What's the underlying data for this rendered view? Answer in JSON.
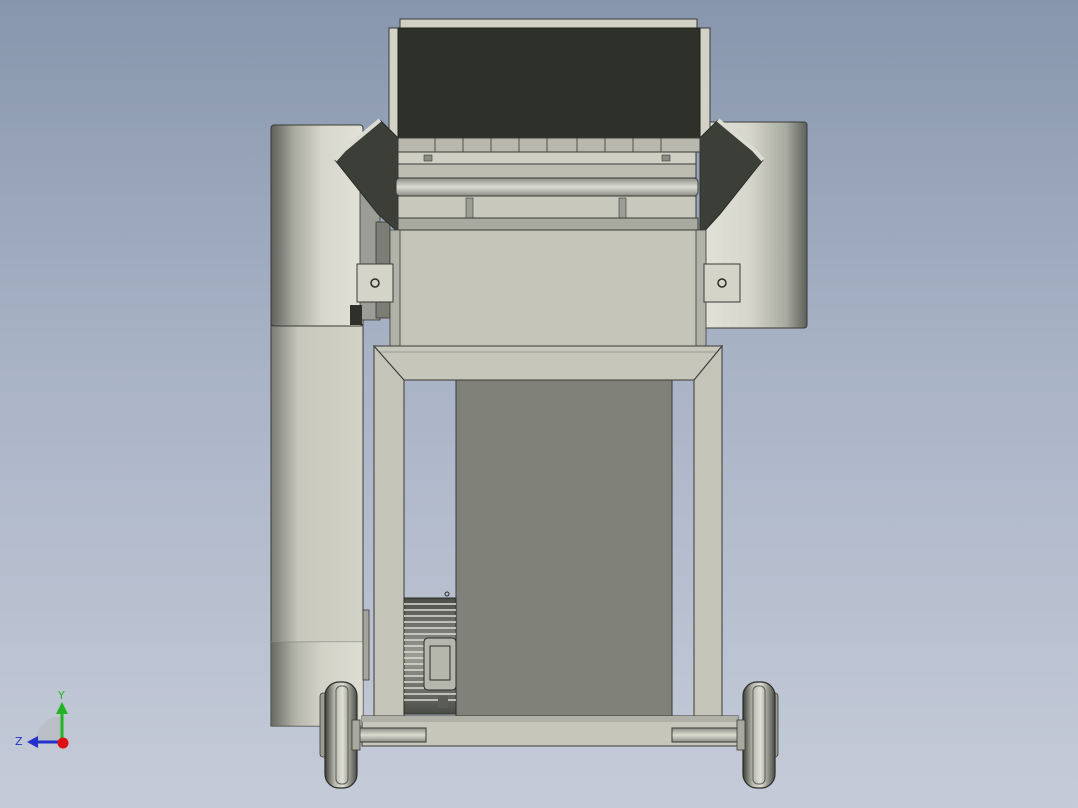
{
  "viewport": {
    "background_top": "#8796ad",
    "background_bottom": "#c5cbd8"
  },
  "model": {
    "body_color": "#c4c4b8",
    "hopper_color": "#2e302a",
    "drum_color": "#d0d0c4",
    "panel_color": "#80827a",
    "outline_color": "#3a3a36"
  },
  "triad": {
    "y_label": "Y",
    "z_label": "Z",
    "y_color": "#22b522",
    "z_color": "#2233cc",
    "x_color": "#dd1111"
  }
}
